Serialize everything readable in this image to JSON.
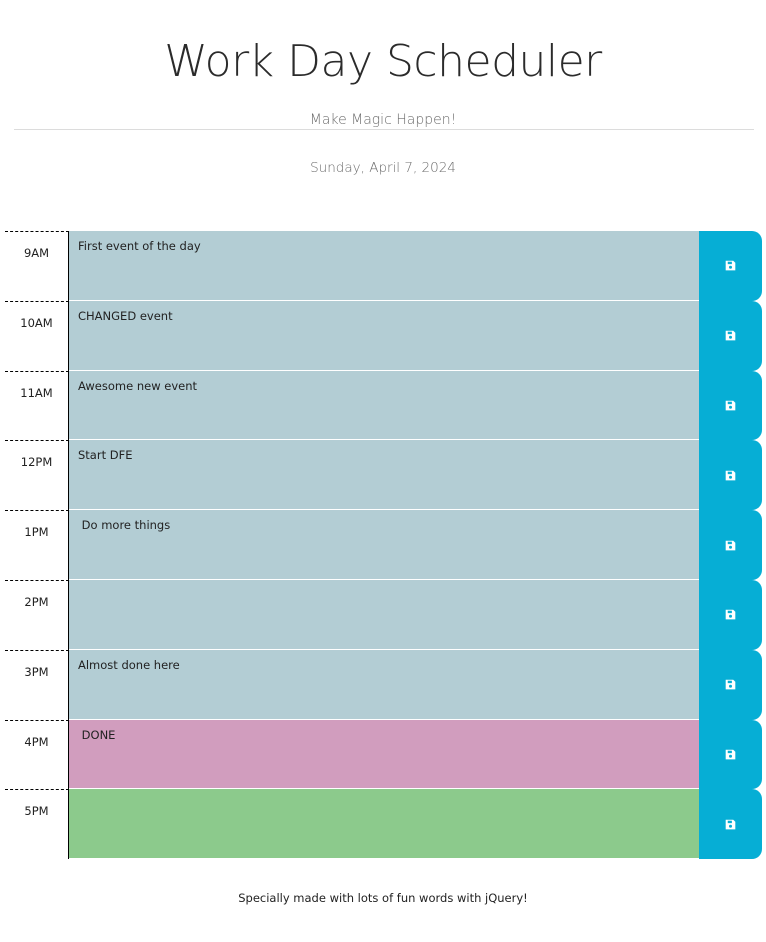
{
  "header": {
    "title": "Work Day Scheduler",
    "tagline": "Make Magic Happen!",
    "current_day": "Sunday, April 7, 2024"
  },
  "schedule": [
    {
      "hour": "9AM",
      "text": "First event of the day",
      "state": "past"
    },
    {
      "hour": "10AM",
      "text": "CHANGED event",
      "state": "past"
    },
    {
      "hour": "11AM",
      "text": "Awesome new event",
      "state": "past"
    },
    {
      "hour": "12PM",
      "text": "Start DFE",
      "state": "past"
    },
    {
      "hour": "1PM",
      "text": " Do more things",
      "state": "past"
    },
    {
      "hour": "2PM",
      "text": "",
      "state": "past"
    },
    {
      "hour": "3PM",
      "text": "Almost done here",
      "state": "past"
    },
    {
      "hour": "4PM",
      "text": " DONE",
      "state": "present"
    },
    {
      "hour": "5PM",
      "text": "",
      "state": "future"
    }
  ],
  "save_icon": "floppy-disk-icon",
  "colors": {
    "past": "#b3cdd4",
    "present": "#d19dbe",
    "future": "#8cca8c",
    "save_button": "#06aed5"
  },
  "footer": {
    "text": "Specially made with lots of fun words with jQuery!"
  }
}
